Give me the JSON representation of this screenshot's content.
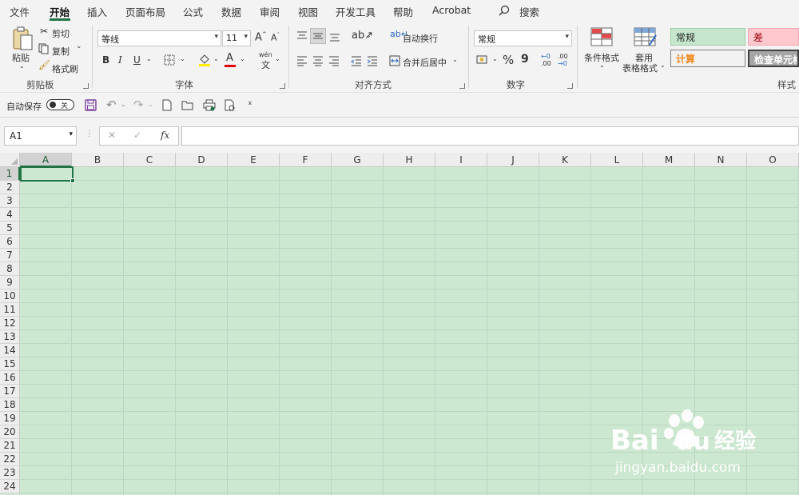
{
  "menu": {
    "tabs": [
      "文件",
      "开始",
      "插入",
      "页面布局",
      "公式",
      "数据",
      "审阅",
      "视图",
      "开发工具",
      "帮助",
      "Acrobat"
    ],
    "active": "开始",
    "search": "搜索"
  },
  "ribbon": {
    "clipboard": {
      "paste": "粘贴",
      "cut": "剪切",
      "copy": "复制",
      "format_painter": "格式刷",
      "label": "剪贴板"
    },
    "font": {
      "name": "等线",
      "size": "11",
      "grow": "A",
      "shrink": "A",
      "bold": "B",
      "italic": "I",
      "underline": "U",
      "font_color_letter": "A",
      "phonetic_top": "wén",
      "phonetic_bottom": "文",
      "label": "字体"
    },
    "alignment": {
      "wrap_text": "自动换行",
      "merge_center": "合并后居中",
      "label": "对齐方式"
    },
    "number": {
      "format": "常规",
      "percent": "%",
      "comma": "9",
      "inc_decimal_top": "←0",
      "inc_decimal_bottom": ".00",
      "dec_decimal_top": ".00",
      "dec_decimal_bottom": "→0",
      "label": "数字"
    },
    "styles": {
      "conditional": "条件格式",
      "table_format_1": "套用",
      "table_format_2": "表格格式",
      "normal": "常规",
      "bad": "差",
      "calc": "计算",
      "check_cell": "检查单元格",
      "label": "样式"
    }
  },
  "qat": {
    "autosave": "自动保存",
    "toggle_state": "关"
  },
  "formula_bar": {
    "name_box": "A1",
    "cancel": "✕",
    "enter": "✓",
    "fx": "fx",
    "content": ""
  },
  "sheet": {
    "columns": [
      "A",
      "B",
      "C",
      "D",
      "E",
      "F",
      "G",
      "H",
      "I",
      "J",
      "K",
      "L",
      "M",
      "N",
      "O"
    ],
    "rows": [
      "1",
      "2",
      "3",
      "4",
      "5",
      "6",
      "7",
      "8",
      "9",
      "10",
      "11",
      "12",
      "13",
      "14",
      "15",
      "16",
      "17",
      "18",
      "19",
      "20",
      "21",
      "22",
      "23",
      "24"
    ],
    "active_cell": "A1"
  },
  "watermark": {
    "brand": "Bai",
    "brand_end": "du",
    "brand_cn": "经验",
    "url": "jingyan.baidu.com"
  },
  "colors": {
    "accent": "#217346",
    "sheet_bg": "#cde8d1",
    "normal_style_bg": "#c6e7cd",
    "bad_style_bg": "#ffc7ce",
    "calc_text": "#f28a1e",
    "font_color_bar": "#e60000",
    "highlight_bar": "#ffee00"
  }
}
